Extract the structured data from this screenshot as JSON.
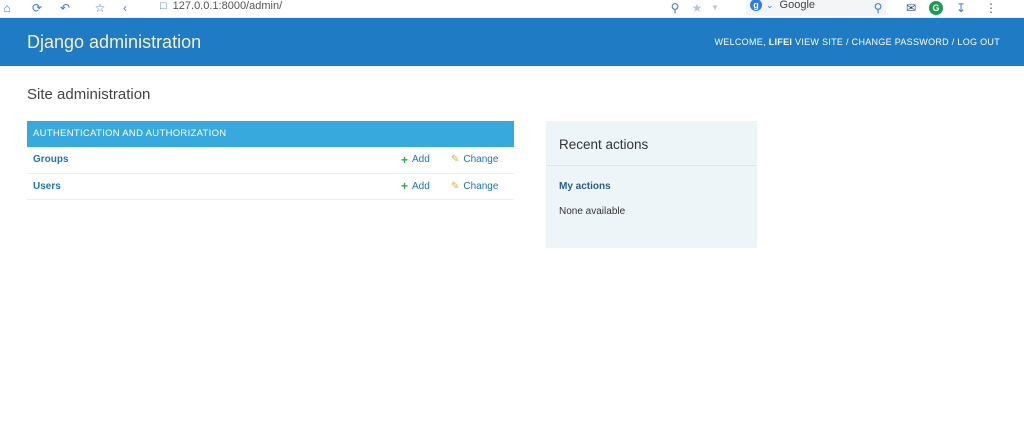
{
  "browser": {
    "url": "127.0.0.1:8000/admin/",
    "search_engine_badge": "g",
    "search_placeholder": "Google"
  },
  "header": {
    "branding": "Django administration",
    "welcome": "WELCOME, ",
    "username": "LIFEI",
    "view_site": "VIEW SITE",
    "change_password": "CHANGE PASSWORD",
    "log_out": "LOG OUT",
    "separator": " / "
  },
  "page": {
    "title": "Site administration"
  },
  "app_module": {
    "caption": "AUTHENTICATION AND AUTHORIZATION",
    "models": [
      {
        "name": "Groups",
        "add_label": "Add",
        "change_label": "Change"
      },
      {
        "name": "Users",
        "add_label": "Add",
        "change_label": "Change"
      }
    ]
  },
  "recent_actions": {
    "title": "Recent actions",
    "subtitle": "My actions",
    "empty_text": "None available"
  },
  "colors": {
    "header_bg": "#1f7bc4",
    "module_caption_bg": "#37a9dd",
    "link": "#2273b8",
    "add_icon": "#35a84b",
    "change_icon": "#e0b030",
    "recent_bg": "#eef5f9"
  }
}
